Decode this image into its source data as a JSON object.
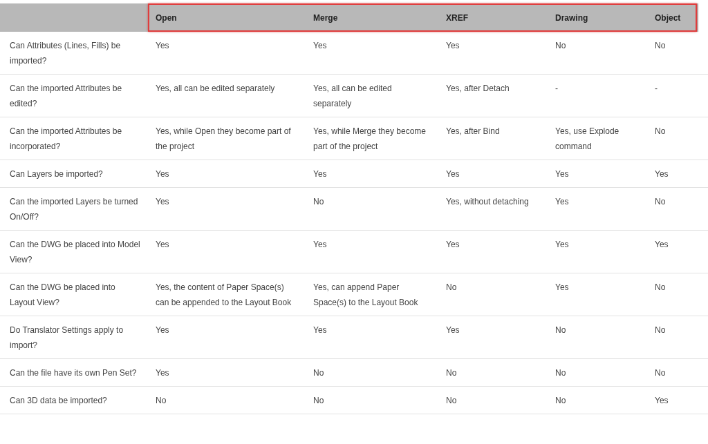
{
  "table": {
    "header_highlighted": true,
    "columns": [
      "Open",
      "Merge",
      "XREF",
      "Drawing",
      "Object"
    ],
    "rows": [
      {
        "question": "Can Attributes (Lines, Fills) be imported?",
        "cells": [
          "Yes",
          "Yes",
          "Yes",
          "No",
          "No"
        ]
      },
      {
        "question": "Can the imported Attributes be edited?",
        "cells": [
          "Yes, all can be edited separately",
          "Yes, all can be edited separately",
          "Yes, after Detach",
          "-",
          "-"
        ]
      },
      {
        "question": "Can the imported Attributes be incorporated?",
        "cells": [
          "Yes, while Open they become part of the project",
          "Yes, while Merge they become part of the project",
          "Yes, after Bind",
          "Yes, use Explode command",
          "No"
        ]
      },
      {
        "question": "Can Layers be imported?",
        "cells": [
          "Yes",
          "Yes",
          "Yes",
          "Yes",
          "Yes"
        ]
      },
      {
        "question": "Can the imported Layers be turned On/Off?",
        "cells": [
          "Yes",
          "No",
          "Yes, without detaching",
          "Yes",
          "No"
        ]
      },
      {
        "question": "Can the DWG be placed into Model View?",
        "cells": [
          "Yes",
          "Yes",
          "Yes",
          "Yes",
          "Yes"
        ]
      },
      {
        "question": "Can the DWG be placed into Layout View?",
        "cells": [
          "Yes, the content of Paper Space(s) can be appended to the Layout Book",
          "Yes, can append Paper Space(s) to the Layout Book",
          "No",
          "Yes",
          "No"
        ]
      },
      {
        "question": "Do Translator Settings apply to import?",
        "cells": [
          "Yes",
          "Yes",
          "Yes",
          "No",
          "No"
        ]
      },
      {
        "question": "Can the file have its own Pen Set?",
        "cells": [
          "Yes",
          "No",
          "No",
          "No",
          "No"
        ]
      },
      {
        "question": "Can 3D data be imported?",
        "cells": [
          "No",
          "No",
          "No",
          "No",
          "Yes"
        ]
      }
    ]
  }
}
